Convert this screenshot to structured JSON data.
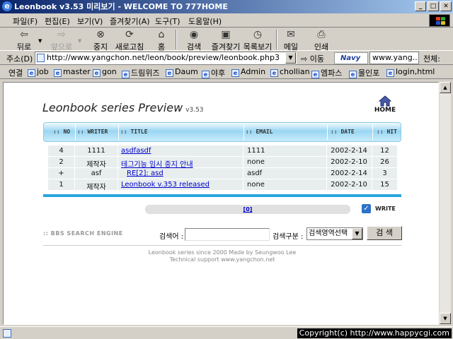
{
  "window": {
    "title": "Leonbook v3.53 미리보기 - WELCOME TO 777HOME",
    "min": "_",
    "max": "□",
    "close": "✕"
  },
  "menu": [
    "파일(F)",
    "편집(E)",
    "보기(V)",
    "즐겨찾기(A)",
    "도구(T)",
    "도움말(H)"
  ],
  "toolbar": {
    "back": "뒤로",
    "forward": "앞으로",
    "stop": "중지",
    "refresh": "새로고침",
    "home": "홈",
    "search": "검색",
    "favorites": "즐겨찾기",
    "history": "목록보기",
    "mail": "메일",
    "print": "인쇄"
  },
  "address": {
    "label": "주소(D)",
    "url": "http://www.yangchon.net/leon/book/preview/leonbook.php3",
    "go": "이동"
  },
  "navy": {
    "logo": "Navy",
    "value": "www.yang..",
    "all": "전체:"
  },
  "links": {
    "label": "연결",
    "items": [
      "job",
      "master",
      "gon",
      "드림위즈",
      "Daum",
      "야후",
      "Admin",
      "chollian",
      "엠파스",
      "몰인포",
      "login,html"
    ]
  },
  "page": {
    "title": "Leonbook series Preview",
    "version": "v3.53",
    "home_label": "HOME",
    "columns": [
      ":: NO",
      ":: WRITER",
      ":: TITLE",
      ":: EMAIL",
      ":: DATE",
      ":: HIT"
    ],
    "rows": [
      {
        "no": "4",
        "writer": "1111",
        "title": "asdfasdf",
        "email": "1111",
        "date": "2002-2-14",
        "hit": "12"
      },
      {
        "no": "2",
        "writer": "제작자",
        "title": "테그기능 임시 중지 안내",
        "email": "none",
        "date": "2002-2-10",
        "hit": "26"
      },
      {
        "no": "+",
        "writer": "asf",
        "title": "RE[2]: asd",
        "email": "asdf",
        "date": "2002-2-14",
        "hit": "3"
      },
      {
        "no": "1",
        "writer": "제작자",
        "title": "Leonbook v.353 released",
        "email": "none",
        "date": "2002-2-10",
        "hit": "15"
      }
    ],
    "pager": "[0]",
    "write_label": "WRITE",
    "search_engine_label": ":: BBS SEARCH ENGINE",
    "search_label": "검색어 :",
    "search_value": "",
    "search_scope_label": "검색구분 :",
    "search_scope_value": "검색영역선택",
    "search_button": "검 색",
    "footer1": "Leonbook series since 2000 Made by Seungwoo Lee",
    "footer2": "Technical support www.yangchon.net"
  },
  "status": {
    "copyright": "Copyright(c) http://www.happycgi.com"
  }
}
